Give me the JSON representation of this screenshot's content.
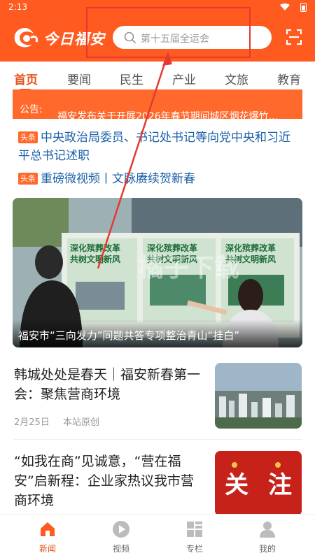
{
  "status": {
    "time": "2:13"
  },
  "header": {
    "logo_text": "今日福安",
    "search_placeholder": "第十五届全运会"
  },
  "tabs": [
    {
      "label": "首页",
      "active": true
    },
    {
      "label": "要闻"
    },
    {
      "label": "民生"
    },
    {
      "label": "产业"
    },
    {
      "label": "文旅"
    },
    {
      "label": "教育"
    }
  ],
  "notice": {
    "label": "公告:",
    "message": "福安发布关于开展2026年春节期间城区烟花爆竹..."
  },
  "headlines": [
    {
      "tag": "头条",
      "text": "中央政治局委员、书记处书记等向党中央和习近平总书记述职"
    },
    {
      "tag": "头条",
      "text": "重磅微视频丨文脉赓续贺新春"
    }
  ],
  "hero": {
    "caption": "福安市“三向发力”同题共答专项整治青山“挂白”",
    "board_text": "深化殡葬改革 共树文明新风",
    "watermark": "橘子下载"
  },
  "articles": [
    {
      "title": "韩城处处是春天｜福安新春第一会：聚焦营商环境",
      "date": "2月25日",
      "source": "本站原创"
    },
    {
      "title": "“如我在商”见诚意，“营在福安”启新程：企业家热议我市营商环境",
      "thumb_text_1": "关",
      "thumb_text_2": "注"
    }
  ],
  "bottom_nav": [
    {
      "label": "新闻",
      "icon": "home-icon",
      "active": true
    },
    {
      "label": "视频",
      "icon": "play-icon"
    },
    {
      "label": "专栏",
      "icon": "grid-icon"
    },
    {
      "label": "我的",
      "icon": "user-icon"
    }
  ],
  "colors": {
    "brand": "#ff5a1f",
    "link": "#1b5fa8",
    "annotation": "#e23a32"
  }
}
